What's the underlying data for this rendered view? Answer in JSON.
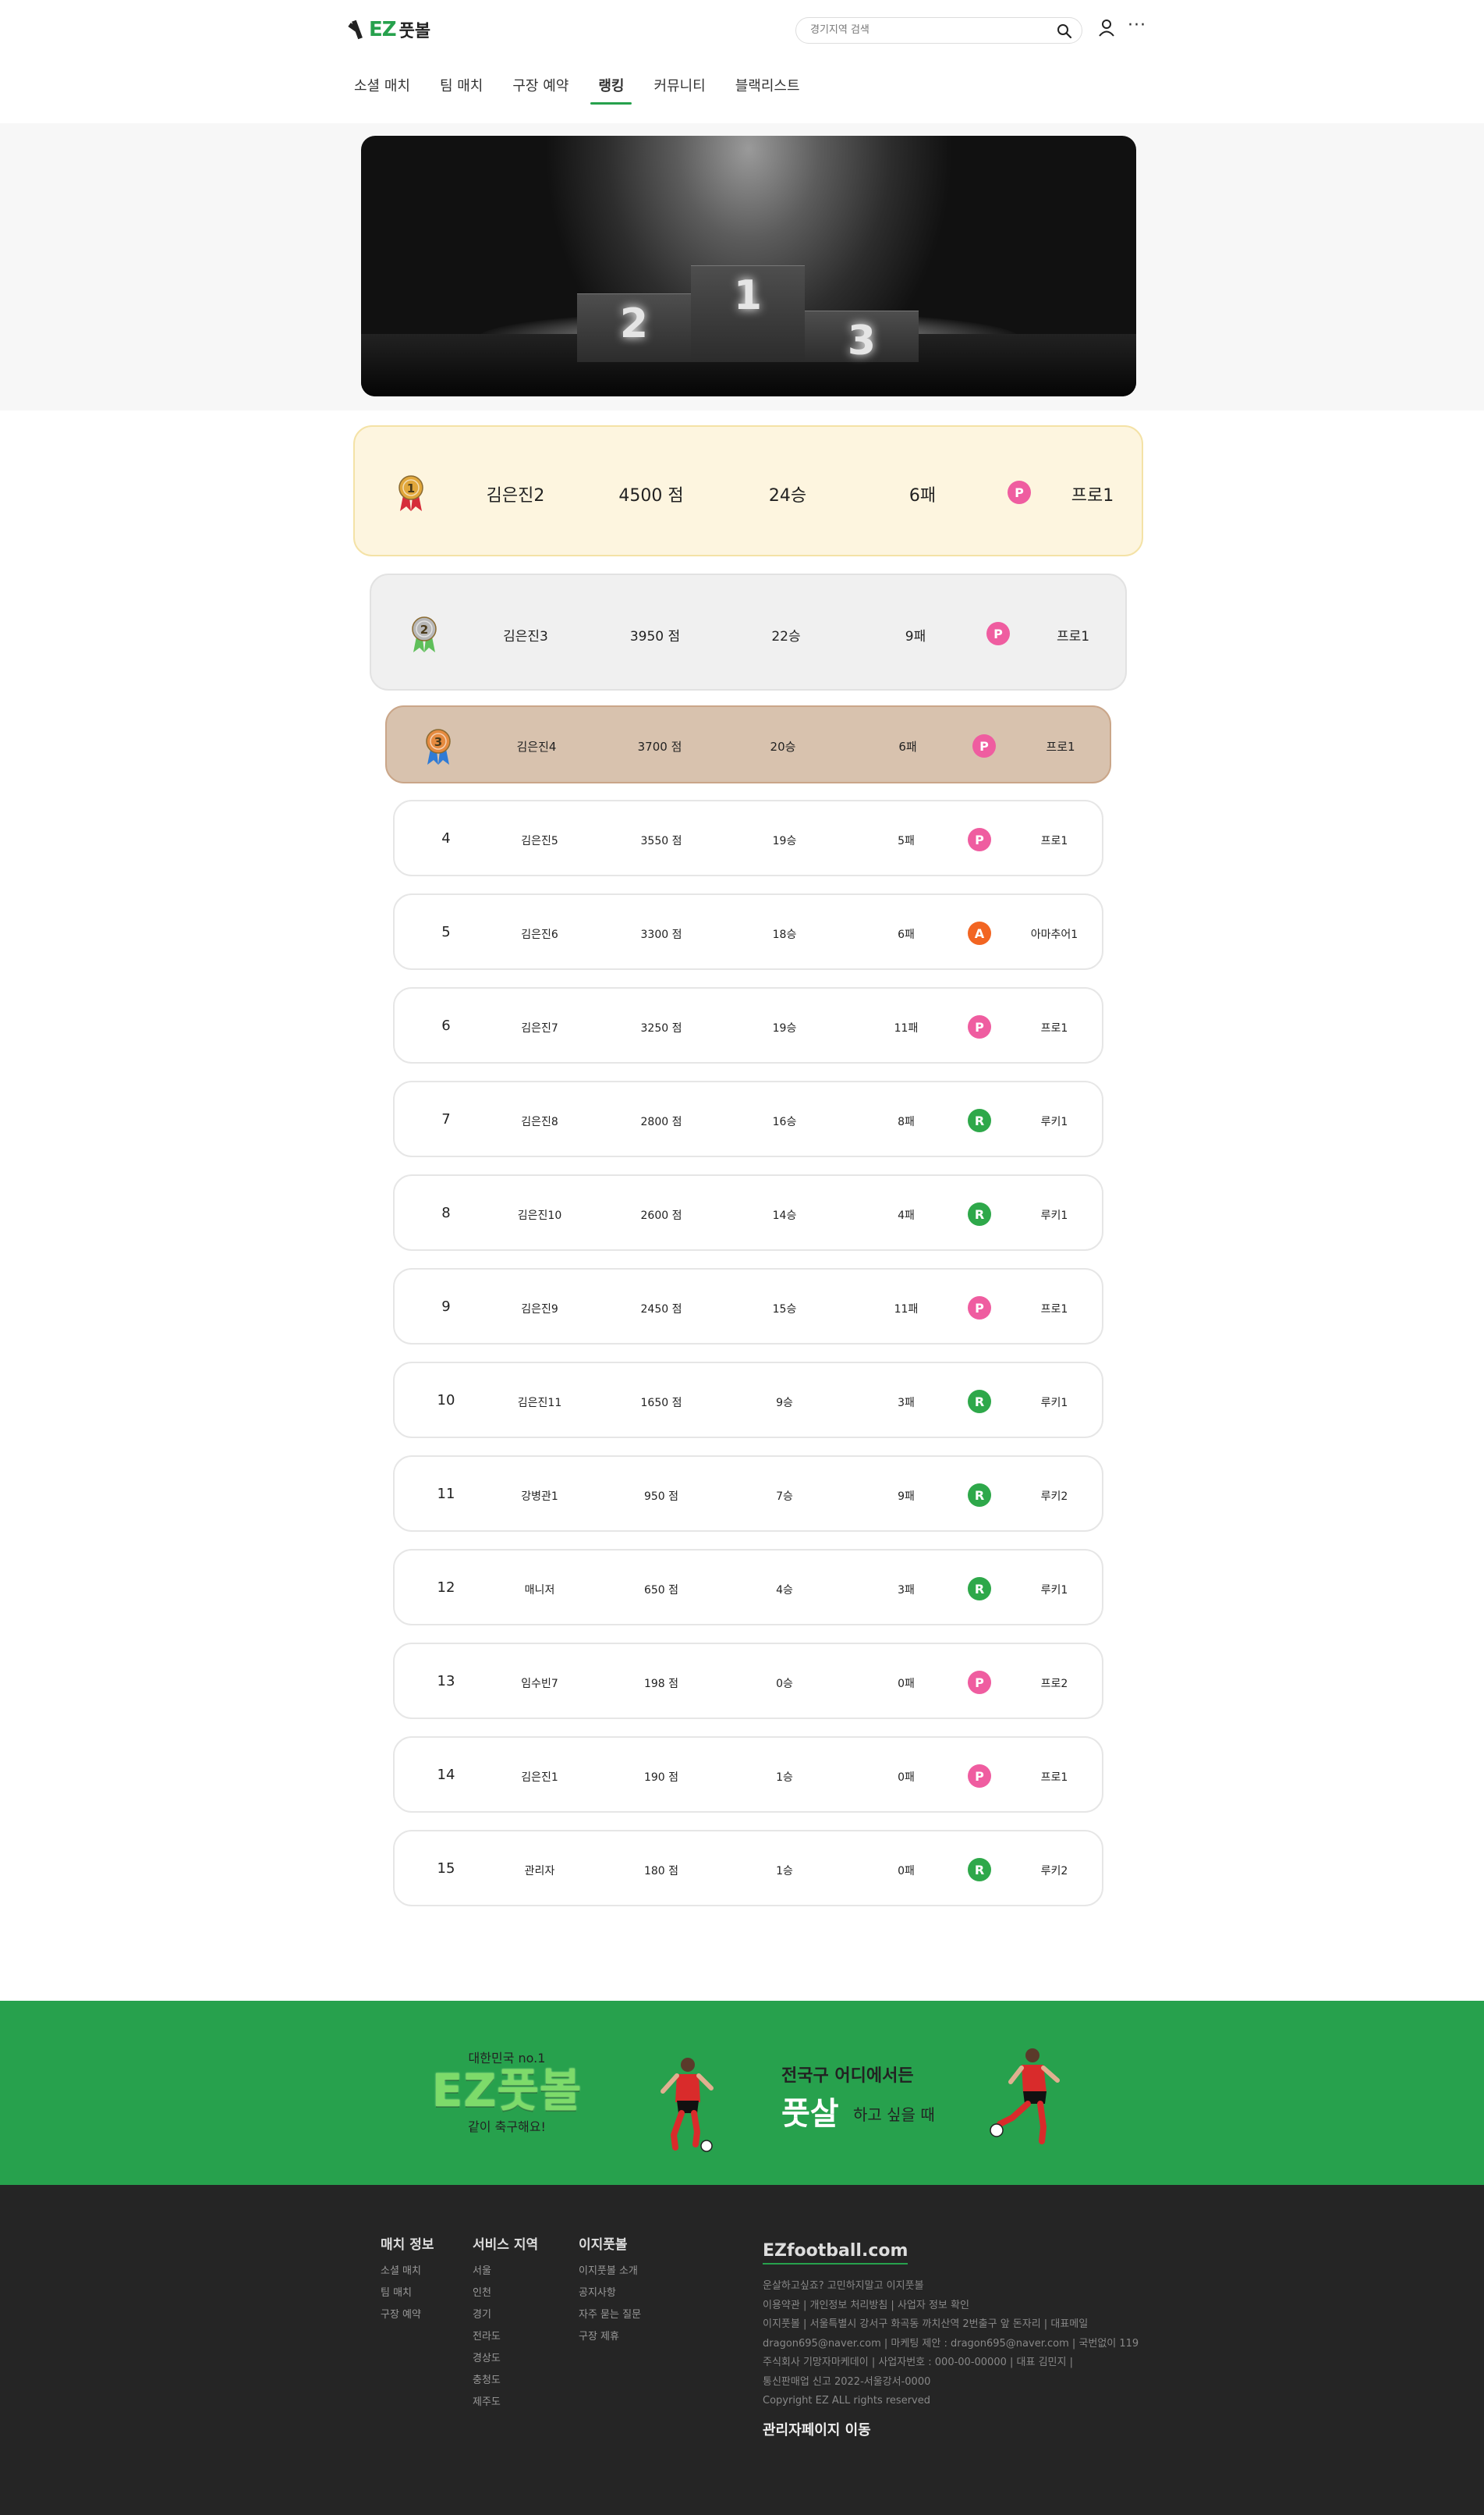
{
  "header": {
    "logo_ez": "EZ",
    "logo_kr": "풋볼",
    "search_placeholder": "경기지역 검색",
    "nav": [
      "소셜 매치",
      "팀 매치",
      "구장 예약",
      "랭킹",
      "커뮤니티",
      "블랙리스트"
    ],
    "active_nav_index": 3
  },
  "hero": {
    "podium": [
      "1",
      "2",
      "3"
    ]
  },
  "ranking": [
    {
      "rank": "1",
      "name": "김은진2",
      "points": "4500 점",
      "wins": "24승",
      "losses": "6패",
      "grade_letter": "P",
      "grade_label": "프로1",
      "grade_color": "#ef5da0"
    },
    {
      "rank": "2",
      "name": "김은진3",
      "points": "3950 점",
      "wins": "22승",
      "losses": "9패",
      "grade_letter": "P",
      "grade_label": "프로1",
      "grade_color": "#ef5da0"
    },
    {
      "rank": "3",
      "name": "김은진4",
      "points": "3700 점",
      "wins": "20승",
      "losses": "6패",
      "grade_letter": "P",
      "grade_label": "프로1",
      "grade_color": "#ef5da0"
    },
    {
      "rank": "4",
      "name": "김은진5",
      "points": "3550 점",
      "wins": "19승",
      "losses": "5패",
      "grade_letter": "P",
      "grade_label": "프로1",
      "grade_color": "#ef5da0"
    },
    {
      "rank": "5",
      "name": "김은진6",
      "points": "3300 점",
      "wins": "18승",
      "losses": "6패",
      "grade_letter": "A",
      "grade_label": "아마추어1",
      "grade_color": "#f26522"
    },
    {
      "rank": "6",
      "name": "김은진7",
      "points": "3250 점",
      "wins": "19승",
      "losses": "11패",
      "grade_letter": "P",
      "grade_label": "프로1",
      "grade_color": "#ef5da0"
    },
    {
      "rank": "7",
      "name": "김은진8",
      "points": "2800 점",
      "wins": "16승",
      "losses": "8패",
      "grade_letter": "R",
      "grade_label": "루키1",
      "grade_color": "#2ea84a"
    },
    {
      "rank": "8",
      "name": "김은진10",
      "points": "2600 점",
      "wins": "14승",
      "losses": "4패",
      "grade_letter": "R",
      "grade_label": "루키1",
      "grade_color": "#2ea84a"
    },
    {
      "rank": "9",
      "name": "김은진9",
      "points": "2450 점",
      "wins": "15승",
      "losses": "11패",
      "grade_letter": "P",
      "grade_label": "프로1",
      "grade_color": "#ef5da0"
    },
    {
      "rank": "10",
      "name": "김은진11",
      "points": "1650 점",
      "wins": "9승",
      "losses": "3패",
      "grade_letter": "R",
      "grade_label": "루키1",
      "grade_color": "#2ea84a"
    },
    {
      "rank": "11",
      "name": "강병관1",
      "points": "950 점",
      "wins": "7승",
      "losses": "9패",
      "grade_letter": "R",
      "grade_label": "루키2",
      "grade_color": "#2ea84a"
    },
    {
      "rank": "12",
      "name": "매니저",
      "points": "650 점",
      "wins": "4승",
      "losses": "3패",
      "grade_letter": "R",
      "grade_label": "루키1",
      "grade_color": "#2ea84a"
    },
    {
      "rank": "13",
      "name": "임수빈7",
      "points": "198 점",
      "wins": "0승",
      "losses": "0패",
      "grade_letter": "P",
      "grade_label": "프로2",
      "grade_color": "#ef5da0"
    },
    {
      "rank": "14",
      "name": "김은진1",
      "points": "190 점",
      "wins": "1승",
      "losses": "0패",
      "grade_letter": "P",
      "grade_label": "프로1",
      "grade_color": "#ef5da0"
    },
    {
      "rank": "15",
      "name": "관리자",
      "points": "180 점",
      "wins": "1승",
      "losses": "0패",
      "grade_letter": "R",
      "grade_label": "루키2",
      "grade_color": "#2ea84a"
    }
  ],
  "banner": {
    "top": "대한민국 no.1",
    "big": "EZ풋볼",
    "bottom": "같이 축구해요!",
    "line1": "전국구 어디에서든",
    "line2_big": "풋살",
    "line2_small": "하고 싶을 때"
  },
  "footer": {
    "columns": [
      {
        "title": "매치 정보",
        "items": [
          "소셜 매치",
          "팀 매치",
          "구장 예약"
        ]
      },
      {
        "title": "서비스 지역",
        "items": [
          "서울",
          "인천",
          "경기",
          "전라도",
          "경상도",
          "충청도",
          "제주도"
        ]
      },
      {
        "title": "이지풋볼",
        "items": [
          "이지풋볼 소개",
          "공지사항",
          "자주 묻는 질문",
          "구장 제휴"
        ]
      }
    ],
    "brand": "EZfootball.com",
    "info": [
      "운살하고싶죠? 고민하지말고 이지풋볼",
      "이용약관 | 개인정보 처리방침 | 사업자 정보 확인",
      "이지풋볼 | 서울특별시 강서구 화곡동 까치산역 2번출구 앞 돈자리 | 대표메일",
      "dragon695@naver.com | 마케팅 제안 : dragon695@naver.com | 국번없이 119",
      "주식회사 기망자마케데이 | 사업자번호 : 000-00-00000 | 대표 김민지 |",
      "통신판매업 신고 2022-서울강서-0000",
      "Copyright EZ ALL rights reserved"
    ],
    "admin": "관리자페이지 이동"
  },
  "colors": {
    "brand_green": "#27a14d",
    "footer_dark": "#252525",
    "gold_bg": "#fdf5df",
    "silver_bg": "#f0f0f0",
    "bronze_bg": "#d8c2ae"
  }
}
